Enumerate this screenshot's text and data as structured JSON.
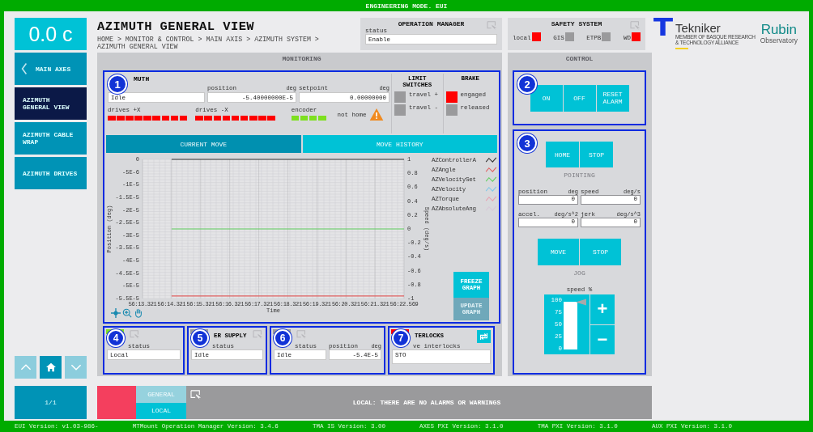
{
  "mode_banner": "ENGINEERING MODE. EUI",
  "temperature": "0.0 c",
  "nav": [
    {
      "label": "MAIN AXES",
      "kind": "back",
      "selected": false
    },
    {
      "label": "AZIMUTH GENERAL VIEW",
      "kind": "page",
      "selected": true
    },
    {
      "label": "AZIMUTH CABLE WRAP",
      "kind": "page",
      "selected": false
    },
    {
      "label": "AZIMUTH DRIVES",
      "kind": "page",
      "selected": false
    }
  ],
  "page_buttons": [
    {
      "kind": "up",
      "disabled": true
    },
    {
      "kind": "home",
      "disabled": false
    },
    {
      "kind": "down",
      "disabled": true
    }
  ],
  "pager": "1/1",
  "title": "AZIMUTH GENERAL VIEW",
  "breadcrumb": "HOME > MONITOR & CONTROL > MAIN AXIS > AZIMUTH SYSTEM > AZIMUTH GENERAL VIEW",
  "operation_manager": {
    "title": "OPERATION MANAGER",
    "status_label": "status",
    "status": "Enable"
  },
  "safety_system": {
    "title": "SAFETY SYSTEM",
    "indicators": [
      {
        "label": "local",
        "on": true
      },
      {
        "label": "GIS",
        "on": false
      },
      {
        "label": "ETPB",
        "on": false
      },
      {
        "label": "WD",
        "on": true
      }
    ]
  },
  "logos": {
    "tekniker": "Tekniker",
    "tekniker_tagline": [
      "MEMBER OF BASQUE RESEARCH",
      "& TECHNOLOGY ALLIANCE"
    ],
    "rubin": "Rubin",
    "rubin_sub": "Observatory"
  },
  "monitoring": {
    "title": "MONITORING",
    "azimuth": {
      "badge": "1",
      "title": "MUTH",
      "status": "Idle",
      "position_label": "position",
      "position_unit": "deg",
      "position": "-5.40000000E-5",
      "setpoint_label": "setpoint",
      "setpoint_unit": "deg",
      "setpoint": "0.00000000",
      "drives_plus": {
        "label": "drives +X",
        "leds": [
          {
            "ok": false
          },
          {
            "ok": false
          },
          {
            "ok": false
          },
          {
            "ok": false
          },
          {
            "ok": false
          },
          {
            "ok": false
          },
          {
            "ok": false
          },
          {
            "ok": false
          },
          {
            "ok": false
          }
        ]
      },
      "drives_minus": {
        "label": "drives -X",
        "leds": [
          {
            "ok": false
          },
          {
            "ok": false
          },
          {
            "ok": false
          },
          {
            "ok": false
          },
          {
            "ok": false
          },
          {
            "ok": false
          },
          {
            "ok": false
          },
          {
            "ok": false
          },
          {
            "ok": false
          }
        ]
      },
      "encoder": {
        "label": "encoder",
        "leds": [
          {
            "ok": true
          },
          {
            "ok": true
          },
          {
            "ok": true
          },
          {
            "ok": true
          }
        ]
      },
      "home_state": "not home",
      "limit_switches": {
        "title": "LIMIT SWITCHES",
        "items": [
          {
            "label": "travel +",
            "on": false
          },
          {
            "label": "travel -",
            "on": false
          }
        ]
      },
      "brake": {
        "title": "BRAKE",
        "items": [
          {
            "label": "engaged",
            "on": true
          },
          {
            "label": "released",
            "on": false
          }
        ]
      }
    },
    "tabs": [
      {
        "label": "CURRENT MOVE",
        "selected": true
      },
      {
        "label": "MOVE HISTORY",
        "selected": false
      }
    ],
    "chart_data": {
      "type": "line",
      "grid": true,
      "xlabel": "Time",
      "ylabel": "Position (deg)",
      "y2label": "Speed (deg/s)",
      "categories": [
        "56:13.321",
        "56:14.321",
        "56:15.321",
        "56:16.321",
        "56:17.321",
        "56:18.321",
        "56:19.321",
        "56:20.321",
        "56:21.321",
        "56:22.569"
      ],
      "ylim": [
        -5.5e-05,
        0
      ],
      "y2lim": [
        -1,
        1
      ],
      "yticks": [
        {
          "value": 0,
          "label": "0"
        },
        {
          "value": -5e-06,
          "label": "-5E-6"
        },
        {
          "value": -1e-05,
          "label": "-1E-5"
        },
        {
          "value": -1.5e-05,
          "label": "-1.5E-5"
        },
        {
          "value": -2e-05,
          "label": "-2E-5"
        },
        {
          "value": -2.5e-05,
          "label": "-2.5E-5"
        },
        {
          "value": -3e-05,
          "label": "-3E-5"
        },
        {
          "value": -3.5e-05,
          "label": "-3.5E-5"
        },
        {
          "value": -4e-05,
          "label": "-4E-5"
        },
        {
          "value": -4.5e-05,
          "label": "-4.5E-5"
        },
        {
          "value": -5e-05,
          "label": "-5E-5"
        },
        {
          "value": -5.5e-05,
          "label": "-5.5E-5"
        }
      ],
      "y2ticks": [
        1,
        0.8,
        0.6,
        0.4,
        0.2,
        0,
        -0.2,
        -0.4,
        -0.6,
        -0.8,
        -1
      ],
      "series": [
        {
          "name": "AZControllerA",
          "color": "#333333",
          "values": [
            null,
            0,
            0,
            0,
            0,
            0,
            0,
            0,
            0,
            0
          ]
        },
        {
          "name": "AZAngle",
          "color": "#e06060",
          "values": [
            null,
            -5.4e-05,
            -5.4e-05,
            -5.4e-05,
            -5.4e-05,
            -5.4e-05,
            -5.4e-05,
            -5.4e-05,
            -5.4e-05,
            -5.4e-05
          ]
        },
        {
          "name": "AZVelocitySet",
          "color": "#60d060",
          "axis": "y2",
          "values": [
            null,
            0,
            0,
            0,
            0,
            0,
            0,
            0,
            0,
            0
          ]
        },
        {
          "name": "AZVelocity",
          "color": "#80c8e8",
          "axis": "y2",
          "values": [
            null,
            null,
            null,
            null,
            null,
            null,
            null,
            null,
            null,
            null
          ]
        },
        {
          "name": "AZTorque",
          "color": "#e8a0b0",
          "axis": "y2",
          "values": [
            null,
            null,
            null,
            null,
            null,
            null,
            null,
            null,
            null,
            null
          ]
        },
        {
          "name": "AZAbsoluteAng",
          "color": "#d8c8d8",
          "values": [
            null,
            null,
            null,
            null,
            null,
            null,
            null,
            null,
            null,
            null
          ]
        }
      ]
    },
    "graph_buttons": [
      {
        "label": "FREEZE GRAPH",
        "disabled": false
      },
      {
        "label": "UPDATE GRAPH",
        "disabled": true
      }
    ],
    "sections": [
      {
        "kind": "status",
        "badge": "4",
        "color": "#7ee020",
        "status_label": "status",
        "status": "Local"
      },
      {
        "kind": "status",
        "badge": "5",
        "color": "#9a9a9c",
        "title": "ER SUPPLY",
        "status_label": "status",
        "status": "Idle"
      },
      {
        "kind": "status_position",
        "badge": "6",
        "color": "#9a9a9c",
        "status_label": "status",
        "status": "Idle",
        "position_label": "position",
        "position_unit": "deg",
        "position": "-5.4E-5"
      },
      {
        "kind": "interlocks",
        "badge": "7",
        "color": "#ff0000",
        "title": "TERLOCKS",
        "list_label": "ve interlocks",
        "list": "STO"
      }
    ]
  },
  "control": {
    "title": "CONTROL",
    "power": {
      "badge": "2",
      "buttons": [
        "ON",
        "OFF",
        "RESET ALARM"
      ]
    },
    "motion": {
      "badge": "3",
      "pointing_buttons": [
        "HOME",
        "STOP"
      ],
      "pointing_label": "POINTING",
      "fields": [
        {
          "label": "position",
          "unit": "deg",
          "value": "0"
        },
        {
          "label": "speed",
          "unit": "deg/s",
          "value": "0"
        },
        {
          "label": "accel.",
          "unit": "deg/s^2",
          "value": "0"
        },
        {
          "label": "jerk",
          "unit": "deg/s^3",
          "value": "0"
        }
      ],
      "jog_buttons": [
        "MOVE",
        "STOP"
      ],
      "jog_label": "JOG",
      "speed_label": "speed %",
      "speed_ticks": [
        "100",
        "75",
        "50",
        "25",
        "0"
      ],
      "level": 0.95,
      "step_buttons": [
        "+",
        "−"
      ]
    }
  },
  "alarms": {
    "tabs": [
      {
        "label": "GENERAL",
        "selected": false
      },
      {
        "label": "LOCAL",
        "selected": true
      }
    ],
    "message": "LOCAL: THERE ARE NO ALARMS OR WARNINGS"
  },
  "versions": [
    "EUI Version: v1.03-986-",
    "MTMount Operation Manager Version: 3.4.6",
    "TMA IS Version: 3.00",
    "AXES PXI Version: 3.1.0",
    "TMA PXI Version: 3.1.0",
    "AUX PXI Version: 3.1.0"
  ]
}
